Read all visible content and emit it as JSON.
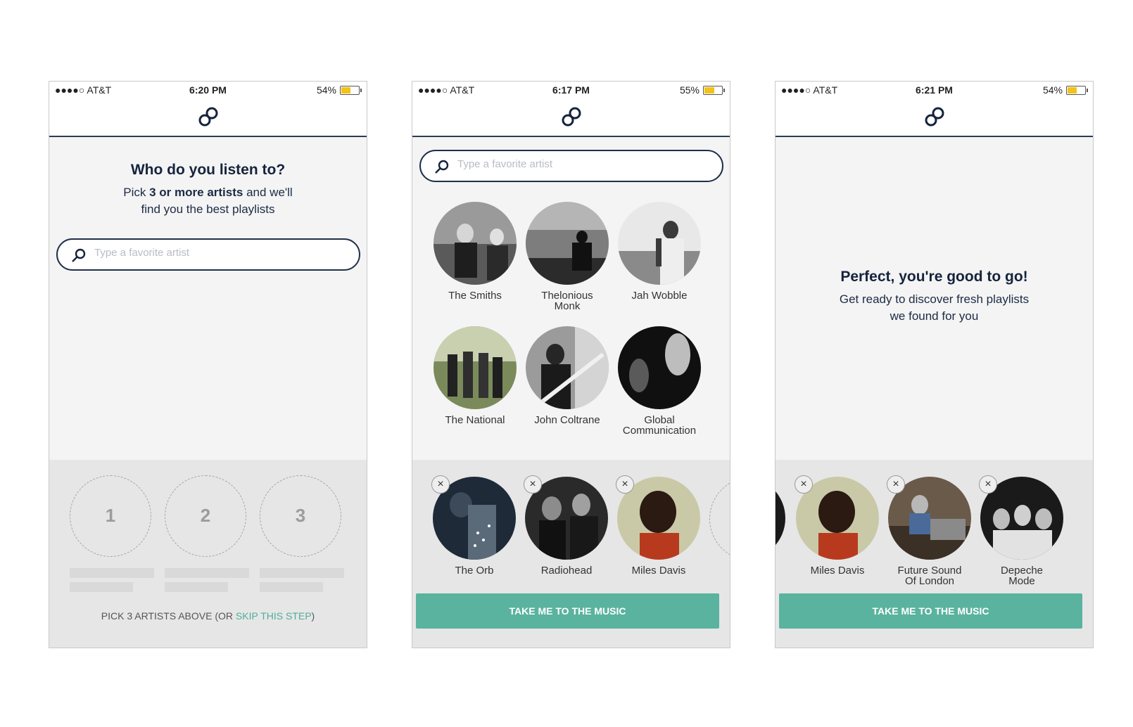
{
  "screen1": {
    "status": {
      "carrier": "●●●●○ AT&T",
      "time": "6:20 PM",
      "battery": "54%"
    },
    "heading": "Who do you listen to?",
    "sub_pre": "Pick ",
    "sub_bold": "3 or more artists",
    "sub_post": " and we'll",
    "sub_line2": "find you the best playlists",
    "search_placeholder": "Type a favorite artist",
    "slots": [
      "1",
      "2",
      "3"
    ],
    "footer_pre": "PICK 3 ARTISTS ABOVE (OR ",
    "footer_link": "SKIP THIS STEP",
    "footer_post": ")"
  },
  "screen2": {
    "status": {
      "carrier": "●●●●○ AT&T",
      "time": "6:17 PM",
      "battery": "55%"
    },
    "search_placeholder": "Type a favorite artist",
    "artists": [
      {
        "line1": "The Smiths",
        "line2": ""
      },
      {
        "line1": "Thelonious",
        "line2": "Monk"
      },
      {
        "line1": "Jah Wobble",
        "line2": ""
      },
      {
        "line1": "The National",
        "line2": ""
      },
      {
        "line1": "John Coltrane",
        "line2": ""
      },
      {
        "line1": "Global",
        "line2": "Communication"
      }
    ],
    "selected": [
      {
        "line1": "The Orb",
        "line2": ""
      },
      {
        "line1": "Radiohead",
        "line2": ""
      },
      {
        "line1": "Miles Davis",
        "line2": ""
      }
    ],
    "remove_icon": "×",
    "cta": "TAKE ME TO THE MUSIC"
  },
  "screen3": {
    "status": {
      "carrier": "●●●●○ AT&T",
      "time": "6:21 PM",
      "battery": "54%"
    },
    "heading": "Perfect, you're good to go!",
    "sub_line1": "Get ready to discover fresh playlists",
    "sub_line2": "we found for you",
    "selected": [
      {
        "line1": "Miles Davis",
        "line2": ""
      },
      {
        "line1": "Future Sound",
        "line2": "Of London"
      },
      {
        "line1": "Depeche",
        "line2": "Mode"
      }
    ],
    "remove_icon": "×",
    "cta": "TAKE ME TO THE MUSIC"
  },
  "icons": {
    "logo": "infinity-link-icon",
    "search": "magnifier-icon",
    "wifi": "wifi-icon",
    "battery": "battery-icon"
  },
  "colors": {
    "accent": "#5ab39e",
    "navy": "#15233d",
    "battery": "#f2c318"
  }
}
